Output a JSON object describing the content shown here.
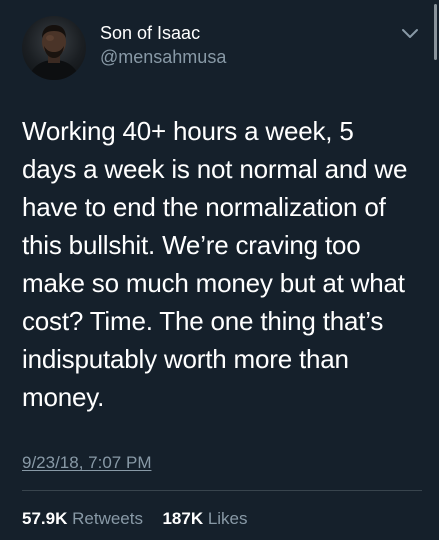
{
  "author": {
    "display_name": "Son of Isaac",
    "handle": "@mensahmusa"
  },
  "tweet": {
    "text": "Working 40+ hours a week, 5\ndays a week is not normal and we\nhave to end the normalization of\nthis bullshit. We’re craving too\nmake so much money but at what\ncost? Time. The one thing that’s\nindisputably worth more than\nmoney.",
    "timestamp": "9/23/18, 7:07 PM"
  },
  "stats": {
    "retweets_count": "57.9K",
    "retweets_label": "Retweets",
    "likes_count": "187K",
    "likes_label": "Likes"
  },
  "icons": {
    "menu": "chevron-down-icon"
  },
  "colors": {
    "background": "#15202b",
    "secondary_text": "#8899a6",
    "divider": "#38444d"
  }
}
